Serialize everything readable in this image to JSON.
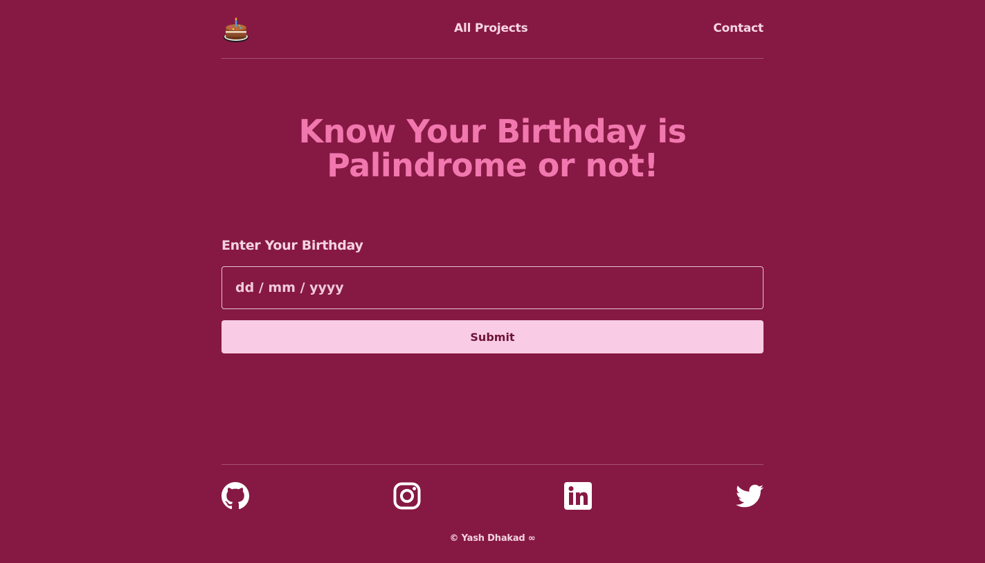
{
  "header": {
    "logo_icon": "birthday-cake-icon",
    "nav": {
      "projects_label": "All Projects",
      "contact_label": "Contact"
    }
  },
  "main": {
    "title": "Know Your Birthday is Palindrome or not!",
    "form": {
      "label": "Enter Your Birthday",
      "date_placeholder": "dd / mm / yyyy",
      "submit_label": "Submit"
    }
  },
  "footer": {
    "social": [
      {
        "icon": "github-icon"
      },
      {
        "icon": "instagram-icon"
      },
      {
        "icon": "linkedin-icon"
      },
      {
        "icon": "twitter-icon"
      }
    ],
    "copyright": "© Yash Dhakad ∞"
  },
  "colors": {
    "background": "#861943",
    "title": "#f178ae",
    "button_bg": "#f9cbe4",
    "button_text": "#6d1437"
  }
}
